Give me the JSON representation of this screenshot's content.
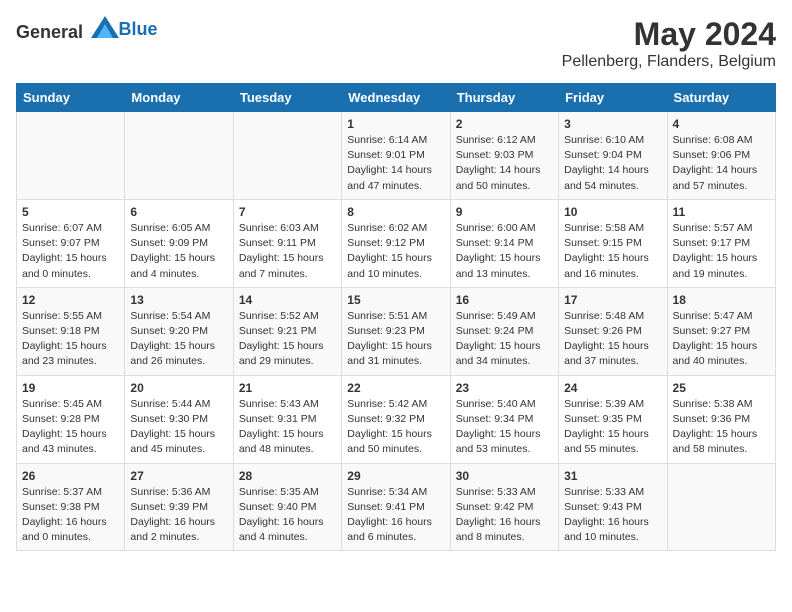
{
  "header": {
    "logo_general": "General",
    "logo_blue": "Blue",
    "month": "May 2024",
    "location": "Pellenberg, Flanders, Belgium"
  },
  "weekdays": [
    "Sunday",
    "Monday",
    "Tuesday",
    "Wednesday",
    "Thursday",
    "Friday",
    "Saturday"
  ],
  "rows": [
    [
      {
        "day": "",
        "info": ""
      },
      {
        "day": "",
        "info": ""
      },
      {
        "day": "",
        "info": ""
      },
      {
        "day": "1",
        "info": "Sunrise: 6:14 AM\nSunset: 9:01 PM\nDaylight: 14 hours and 47 minutes."
      },
      {
        "day": "2",
        "info": "Sunrise: 6:12 AM\nSunset: 9:03 PM\nDaylight: 14 hours and 50 minutes."
      },
      {
        "day": "3",
        "info": "Sunrise: 6:10 AM\nSunset: 9:04 PM\nDaylight: 14 hours and 54 minutes."
      },
      {
        "day": "4",
        "info": "Sunrise: 6:08 AM\nSunset: 9:06 PM\nDaylight: 14 hours and 57 minutes."
      }
    ],
    [
      {
        "day": "5",
        "info": "Sunrise: 6:07 AM\nSunset: 9:07 PM\nDaylight: 15 hours and 0 minutes."
      },
      {
        "day": "6",
        "info": "Sunrise: 6:05 AM\nSunset: 9:09 PM\nDaylight: 15 hours and 4 minutes."
      },
      {
        "day": "7",
        "info": "Sunrise: 6:03 AM\nSunset: 9:11 PM\nDaylight: 15 hours and 7 minutes."
      },
      {
        "day": "8",
        "info": "Sunrise: 6:02 AM\nSunset: 9:12 PM\nDaylight: 15 hours and 10 minutes."
      },
      {
        "day": "9",
        "info": "Sunrise: 6:00 AM\nSunset: 9:14 PM\nDaylight: 15 hours and 13 minutes."
      },
      {
        "day": "10",
        "info": "Sunrise: 5:58 AM\nSunset: 9:15 PM\nDaylight: 15 hours and 16 minutes."
      },
      {
        "day": "11",
        "info": "Sunrise: 5:57 AM\nSunset: 9:17 PM\nDaylight: 15 hours and 19 minutes."
      }
    ],
    [
      {
        "day": "12",
        "info": "Sunrise: 5:55 AM\nSunset: 9:18 PM\nDaylight: 15 hours and 23 minutes."
      },
      {
        "day": "13",
        "info": "Sunrise: 5:54 AM\nSunset: 9:20 PM\nDaylight: 15 hours and 26 minutes."
      },
      {
        "day": "14",
        "info": "Sunrise: 5:52 AM\nSunset: 9:21 PM\nDaylight: 15 hours and 29 minutes."
      },
      {
        "day": "15",
        "info": "Sunrise: 5:51 AM\nSunset: 9:23 PM\nDaylight: 15 hours and 31 minutes."
      },
      {
        "day": "16",
        "info": "Sunrise: 5:49 AM\nSunset: 9:24 PM\nDaylight: 15 hours and 34 minutes."
      },
      {
        "day": "17",
        "info": "Sunrise: 5:48 AM\nSunset: 9:26 PM\nDaylight: 15 hours and 37 minutes."
      },
      {
        "day": "18",
        "info": "Sunrise: 5:47 AM\nSunset: 9:27 PM\nDaylight: 15 hours and 40 minutes."
      }
    ],
    [
      {
        "day": "19",
        "info": "Sunrise: 5:45 AM\nSunset: 9:28 PM\nDaylight: 15 hours and 43 minutes."
      },
      {
        "day": "20",
        "info": "Sunrise: 5:44 AM\nSunset: 9:30 PM\nDaylight: 15 hours and 45 minutes."
      },
      {
        "day": "21",
        "info": "Sunrise: 5:43 AM\nSunset: 9:31 PM\nDaylight: 15 hours and 48 minutes."
      },
      {
        "day": "22",
        "info": "Sunrise: 5:42 AM\nSunset: 9:32 PM\nDaylight: 15 hours and 50 minutes."
      },
      {
        "day": "23",
        "info": "Sunrise: 5:40 AM\nSunset: 9:34 PM\nDaylight: 15 hours and 53 minutes."
      },
      {
        "day": "24",
        "info": "Sunrise: 5:39 AM\nSunset: 9:35 PM\nDaylight: 15 hours and 55 minutes."
      },
      {
        "day": "25",
        "info": "Sunrise: 5:38 AM\nSunset: 9:36 PM\nDaylight: 15 hours and 58 minutes."
      }
    ],
    [
      {
        "day": "26",
        "info": "Sunrise: 5:37 AM\nSunset: 9:38 PM\nDaylight: 16 hours and 0 minutes."
      },
      {
        "day": "27",
        "info": "Sunrise: 5:36 AM\nSunset: 9:39 PM\nDaylight: 16 hours and 2 minutes."
      },
      {
        "day": "28",
        "info": "Sunrise: 5:35 AM\nSunset: 9:40 PM\nDaylight: 16 hours and 4 minutes."
      },
      {
        "day": "29",
        "info": "Sunrise: 5:34 AM\nSunset: 9:41 PM\nDaylight: 16 hours and 6 minutes."
      },
      {
        "day": "30",
        "info": "Sunrise: 5:33 AM\nSunset: 9:42 PM\nDaylight: 16 hours and 8 minutes."
      },
      {
        "day": "31",
        "info": "Sunrise: 5:33 AM\nSunset: 9:43 PM\nDaylight: 16 hours and 10 minutes."
      },
      {
        "day": "",
        "info": ""
      }
    ]
  ]
}
